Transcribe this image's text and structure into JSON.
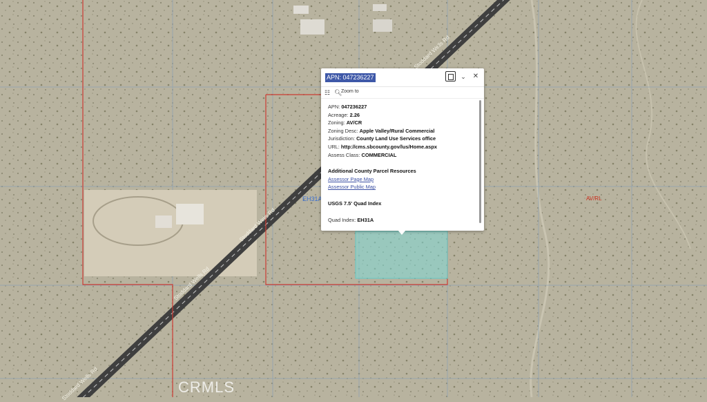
{
  "map": {
    "quad_label": "EH31A",
    "zone_label": "AV/RL",
    "road_labels": [
      "Stoddard Wells Rd",
      "Stoddard Wells Rd",
      "Stoddard Wells Rd",
      "Stoddard Wells Rd"
    ],
    "watermark": "CRMLS",
    "colors": {
      "parcel_line": "#cc3b32",
      "highlight_fill": "#7fd9d6",
      "road": "#4a4a4a",
      "terrain": "#b8b39f"
    }
  },
  "popup": {
    "title": "APN: 047236227",
    "actions": {
      "zoom_to": "Zoom to"
    },
    "icons": [
      "dock-icon",
      "chevron-down-icon",
      "close-icon",
      "actions-grid-icon",
      "zoom-icon"
    ],
    "fields": [
      {
        "label": "APN:",
        "value": "047236227"
      },
      {
        "label": "Acreage:",
        "value": "2.26"
      },
      {
        "label": "Zoning:",
        "value": "AV/CR"
      },
      {
        "label": "Zoning Desc:",
        "value": "Apple Valley/Rural Commercial"
      },
      {
        "label": "Jurisdiction:",
        "value": "County Land Use Services office"
      },
      {
        "label": "URL:",
        "value": "http://cms.sbcounty.gov/lus/Home.aspx"
      },
      {
        "label": "Assess Class:",
        "value": "COMMERCIAL"
      }
    ],
    "resources_heading": "Additional County Parcel Resources",
    "links": [
      "Assessor Page Map",
      "Assessor Public Map"
    ],
    "usgs_heading": "USGS 7.5' Quad Index",
    "quad": {
      "label": "Quad Index:",
      "value": "EH31A"
    }
  }
}
